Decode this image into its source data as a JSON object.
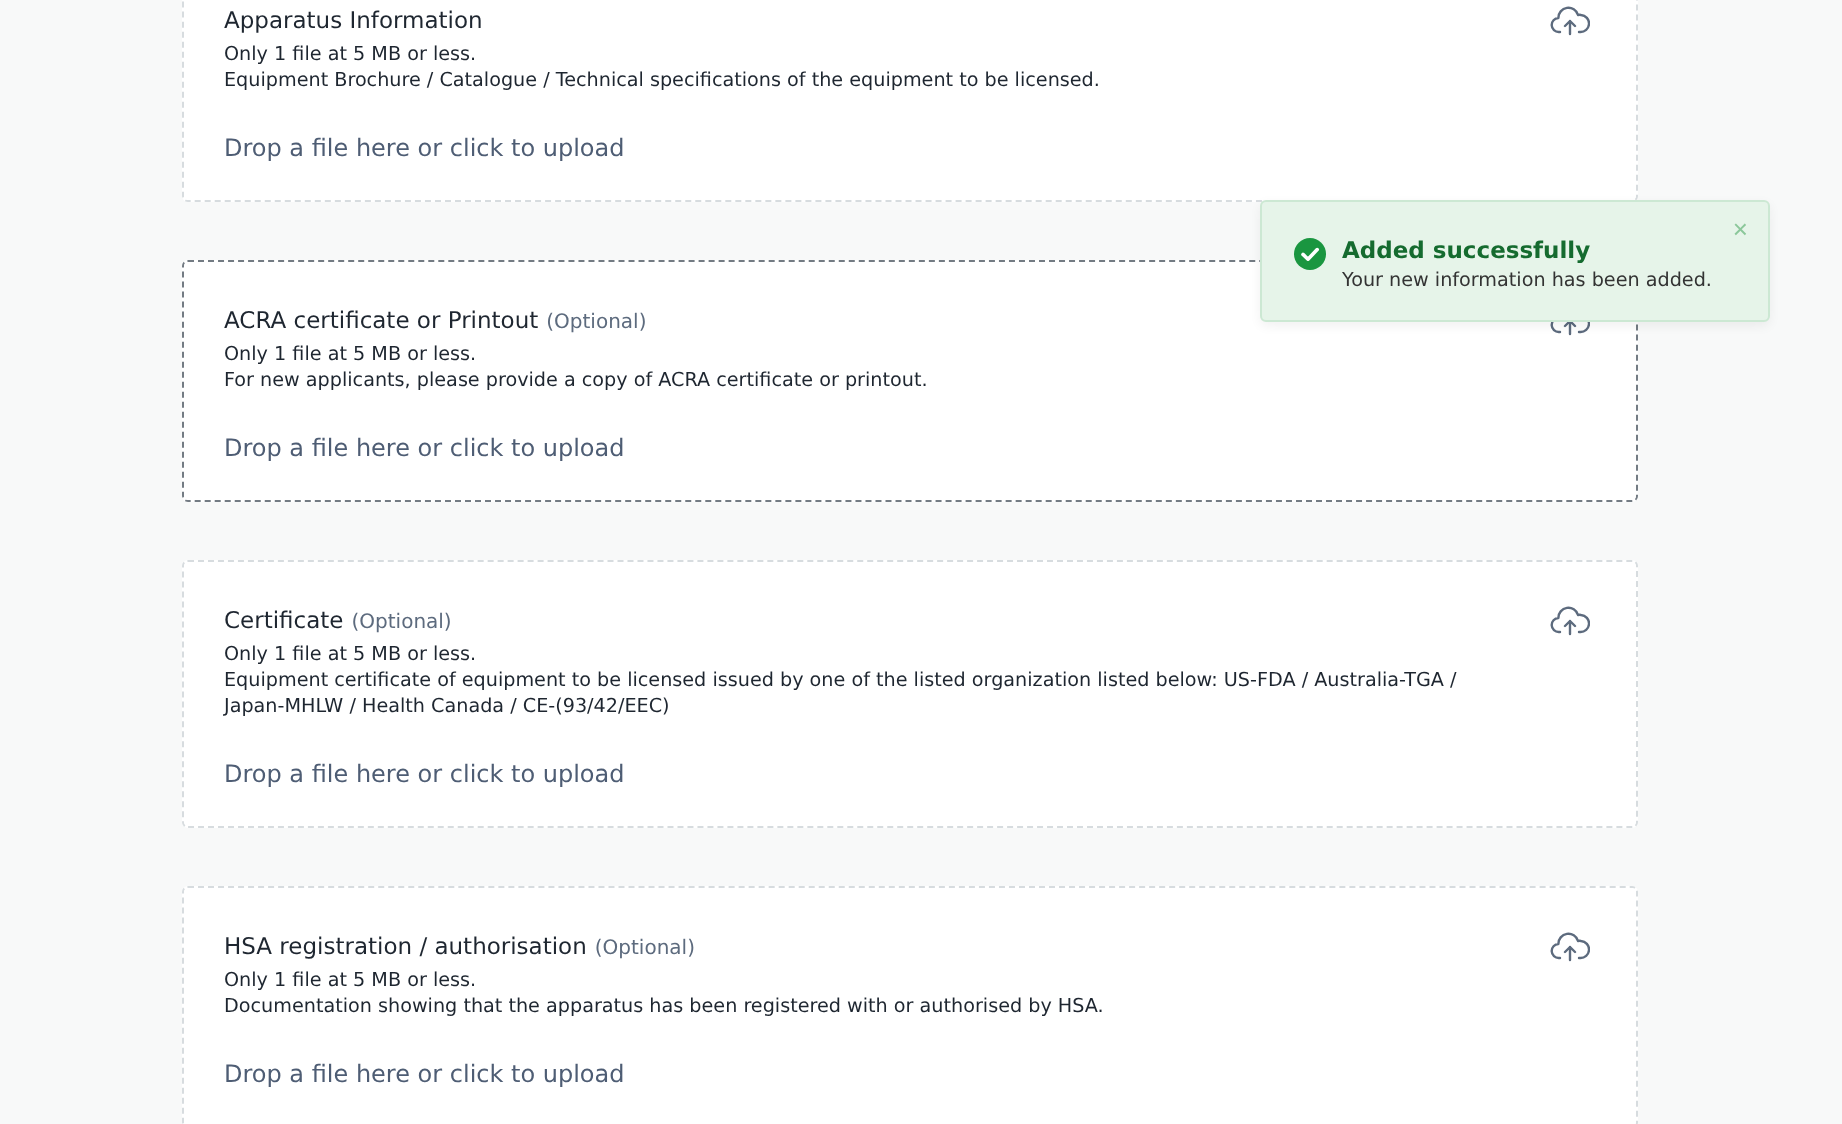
{
  "uploads": [
    {
      "title": "Apparatus Information",
      "lines": [
        "Only 1 file at 5 MB or less.",
        "Equipment Brochure / Catalogue / Technical specifications of the equipment to be licensed."
      ],
      "dropzone": "Drop a file here or click to upload",
      "active": false
    },
    {
      "title": "ACRA certificate or Printout",
      "optional": "(Optional)",
      "lines": [
        "Only 1 file at 5 MB or less.",
        "For new applicants, please provide a copy of ACRA certificate or printout."
      ],
      "dropzone": "Drop a file here or click to upload",
      "active": true
    },
    {
      "title": "Certificate",
      "optional": "(Optional)",
      "lines": [
        "Only 1 file at 5 MB or less.",
        "Equipment certificate of equipment to be licensed issued by one of the listed organization listed below: US-FDA / Australia-TGA / Japan-MHLW / Health Canada / CE-(93/42/EEC)"
      ],
      "dropzone": "Drop a file here or click to upload",
      "active": false
    },
    {
      "title": "HSA registration / authorisation",
      "optional": "(Optional)",
      "lines": [
        "Only 1 file at 5 MB or less.",
        "Documentation showing that the apparatus has been registered with or authorised by HSA."
      ],
      "dropzone": "Drop a file here or click to upload",
      "active": false
    }
  ],
  "toast": {
    "title": "Added successfully",
    "message": "Your new information has been added.",
    "close": "×"
  }
}
